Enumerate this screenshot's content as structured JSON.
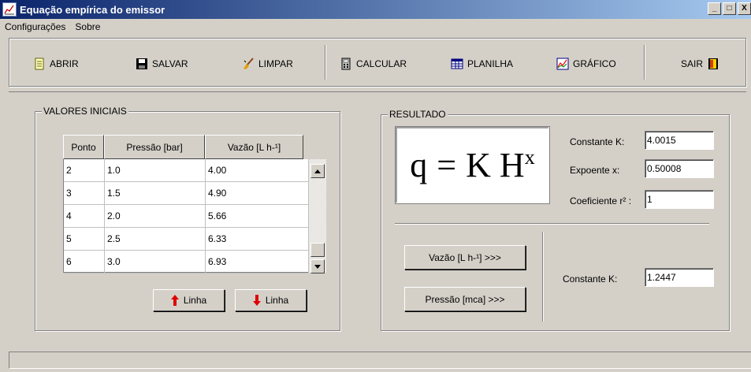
{
  "window": {
    "title": "Equação empírica do emissor",
    "minimize": "_",
    "maximize": "□",
    "close": "X"
  },
  "menu": [
    {
      "label": "Configurações"
    },
    {
      "label": "Sobre"
    }
  ],
  "toolbar": {
    "abrir": "ABRIR",
    "salvar": "SALVAR",
    "limpar": "LIMPAR",
    "calcular": "CALCULAR",
    "planilha": "PLANILHA",
    "grafico": "GRÁFICO",
    "sair": "SAIR"
  },
  "valores_iniciais": {
    "title": "VALORES INICIAIS",
    "columns": [
      "Ponto",
      "Pressão [bar]",
      "Vazão [L h-¹]"
    ],
    "rows": [
      [
        "2",
        "1.0",
        "4.00"
      ],
      [
        "3",
        "1.5",
        "4.90"
      ],
      [
        "4",
        "2.0",
        "5.66"
      ],
      [
        "5",
        "2.5",
        "6.33"
      ],
      [
        "6",
        "3.0",
        "6.93"
      ]
    ],
    "add_row_label": "Linha",
    "remove_row_label": "Linha"
  },
  "resultado": {
    "title": "RESULTADO",
    "formula": {
      "lhs": "q",
      "eq": "=",
      "rhs": "K H",
      "exp": "x"
    },
    "constante_k_label": "Constante K:",
    "constante_k_value": "4.0015",
    "expoente_label": "Expoente x:",
    "expoente_value": "0.50008",
    "coeficiente_label": "Coeficiente r² :",
    "coeficiente_value": "1",
    "vazao_button": "Vazão [L h-¹] >>>",
    "pressao_button": "Pressão [mca] >>>",
    "constante_k2_label": "Constante K:",
    "constante_k2_value": "1.2447"
  },
  "colors": {
    "face": "#d4d0c8",
    "title_start": "#0a246a",
    "title_end": "#a6caf0",
    "arrow_red": "#e00000"
  }
}
